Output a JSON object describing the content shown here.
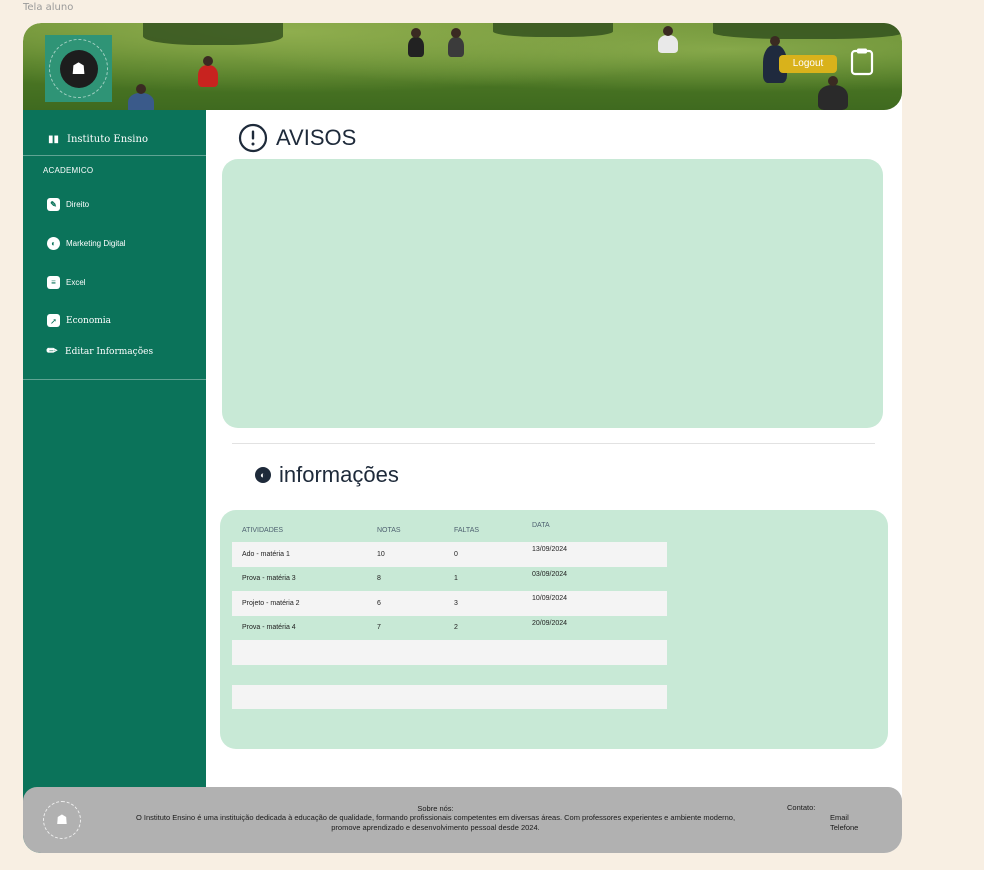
{
  "frame_label": "Tela aluno",
  "header": {
    "logo_text": "INSTITUTO ENSINO",
    "logout_label": "Logout",
    "logout_color": "#d9b21b",
    "clipboard_icon": "clipboard-icon"
  },
  "sidebar": {
    "brand": "Instituto Ensino",
    "section": "ACADEMICO",
    "items": [
      {
        "label": "Direito",
        "icon": "book-icon"
      },
      {
        "label": "Marketing Digital",
        "icon": "megaphone-icon"
      },
      {
        "label": "Excel",
        "icon": "clipboard-icon"
      },
      {
        "label": "Economia",
        "icon": "trend-icon"
      },
      {
        "label": "Editar Informações",
        "icon": "pencil-icon"
      }
    ],
    "color": "#0b735a"
  },
  "main": {
    "avisos_title": "AVISOS",
    "info_title": "informações",
    "table": {
      "headers": [
        "ATIVIDADES",
        "NOTAS",
        "FALTAS",
        "DATA"
      ],
      "rows": [
        [
          "Ado - matéria 1",
          "10",
          "0",
          "13/09/2024"
        ],
        [
          "Prova - matéria 3",
          "8",
          "1",
          "03/09/2024"
        ],
        [
          "Projeto - matéria 2",
          "6",
          "3",
          "10/09/2024"
        ],
        [
          "Prova - matéria 4",
          "7",
          "2",
          "20/09/2024"
        ]
      ]
    },
    "panel_color": "#c8e9d6"
  },
  "footer": {
    "about_title": "Sobre nós:",
    "about_text": "O Instituto Ensino é uma instituição dedicada à educação de qualidade, formando profissionais competentes em diversas áreas. Com professores experientes e ambiente moderno, promove aprendizado e desenvolvimento pessoal desde 2024.",
    "contact_title": "Contato:",
    "contact_email": "Email",
    "contact_phone": "Telefone"
  }
}
